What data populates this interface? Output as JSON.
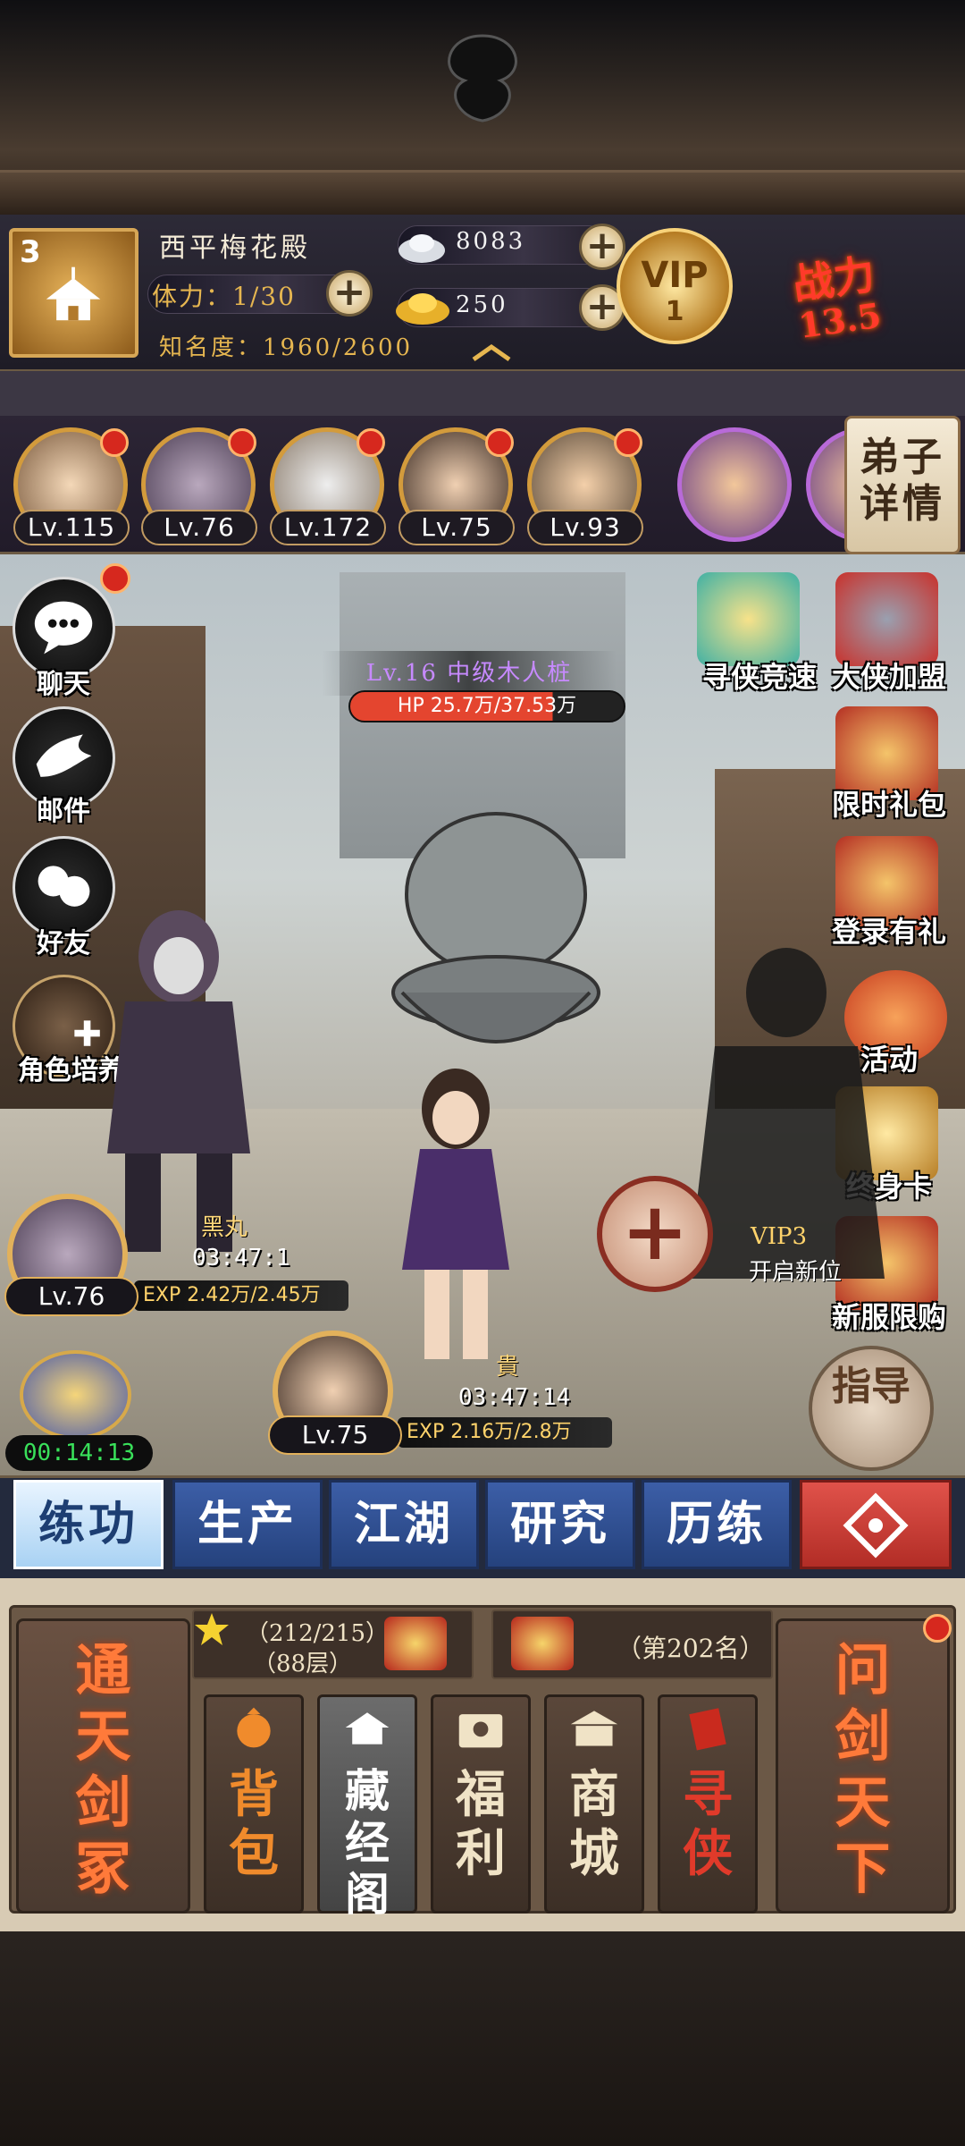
{
  "header": {
    "sect_level": "3",
    "sect_name": "西平梅花殿",
    "stamina": "体力：1/30",
    "fame": "知名度：1960/2600",
    "silver": "8083",
    "gold": "250",
    "vip_label": "VIP",
    "vip_level": "1",
    "power_label": "战力",
    "power_value": "13.5"
  },
  "disciples": {
    "items": [
      {
        "level": "Lv.115"
      },
      {
        "level": "Lv.76"
      },
      {
        "level": "Lv.172"
      },
      {
        "level": "Lv.75"
      },
      {
        "level": "Lv.93"
      }
    ],
    "detail_button": "弟子详情"
  },
  "scene": {
    "left_buttons": [
      "聊天",
      "邮件",
      "好友",
      "角色培养"
    ],
    "right_buttons": [
      "寻侠竞速",
      "大侠加盟",
      "限时礼包",
      "登录有礼",
      "活动",
      "终身卡",
      "新服限购"
    ],
    "enemy": {
      "name": "Lv.16 中级木人桩",
      "hp": "HP 25.7万/37.53万"
    },
    "hero1": {
      "name": "黑丸",
      "timer": "03:47:1",
      "level": "Lv.76",
      "exp": "EXP 2.42万/2.45万"
    },
    "hero2": {
      "name": "貴",
      "timer": "03:47:14",
      "level": "Lv.75",
      "exp": "EXP 2.16万/2.8万"
    },
    "vip_promo": {
      "title": "VIP3",
      "text": "开启新位"
    },
    "guide": "指导",
    "building_timer": "00:14:13"
  },
  "tabs": [
    "练功",
    "生产",
    "江湖",
    "研究",
    "历练"
  ],
  "menu": {
    "left_card": "通天剑冢",
    "right_card": "问剑天下",
    "tower_progress": "（212/215）",
    "tower_floor": "（88层）",
    "rank": "（第202名）",
    "cards": [
      "背包",
      "藏经阁",
      "福利",
      "商城",
      "寻侠"
    ]
  },
  "colors": {
    "gold": "#d39b3c",
    "tab_blue": "#2f4d8f",
    "tab_active": "#a9d2f3",
    "red_dot": "#d6281e",
    "power_red": "#ff3a2a",
    "timer_green": "#39e05a"
  }
}
